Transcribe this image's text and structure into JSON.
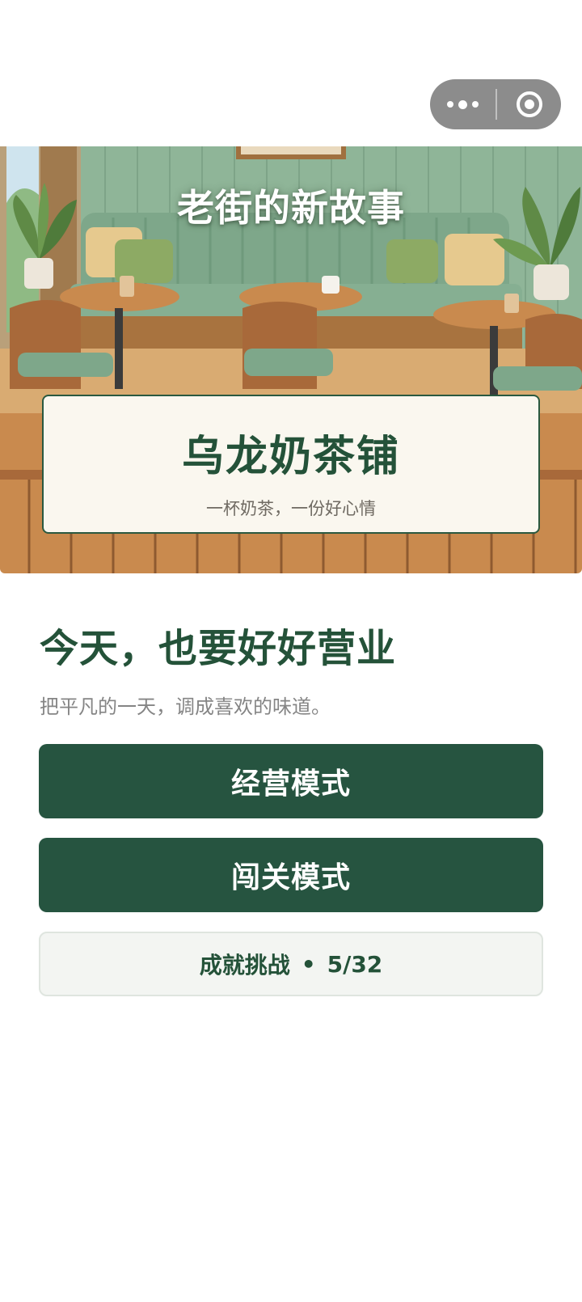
{
  "capsule": {
    "more_icon": "more-dots-icon",
    "close_icon": "target-circle-icon"
  },
  "hero": {
    "title": "老街的新故事",
    "shop_name": "乌龙奶茶铺",
    "slogan": "一杯奶茶，一份好心情"
  },
  "main": {
    "headline": "今天，也要好好营业",
    "subline": "把平凡的一天，调成喜欢的味道。"
  },
  "buttons": {
    "manage_label": "经营模式",
    "level_label": "闯关模式",
    "achievement_label": "成就挑战",
    "achievement_progress": "5/32"
  },
  "colors": {
    "brand_green": "#265440",
    "accent_wood": "#c98a4e",
    "sign_bg": "#faf7ef"
  }
}
